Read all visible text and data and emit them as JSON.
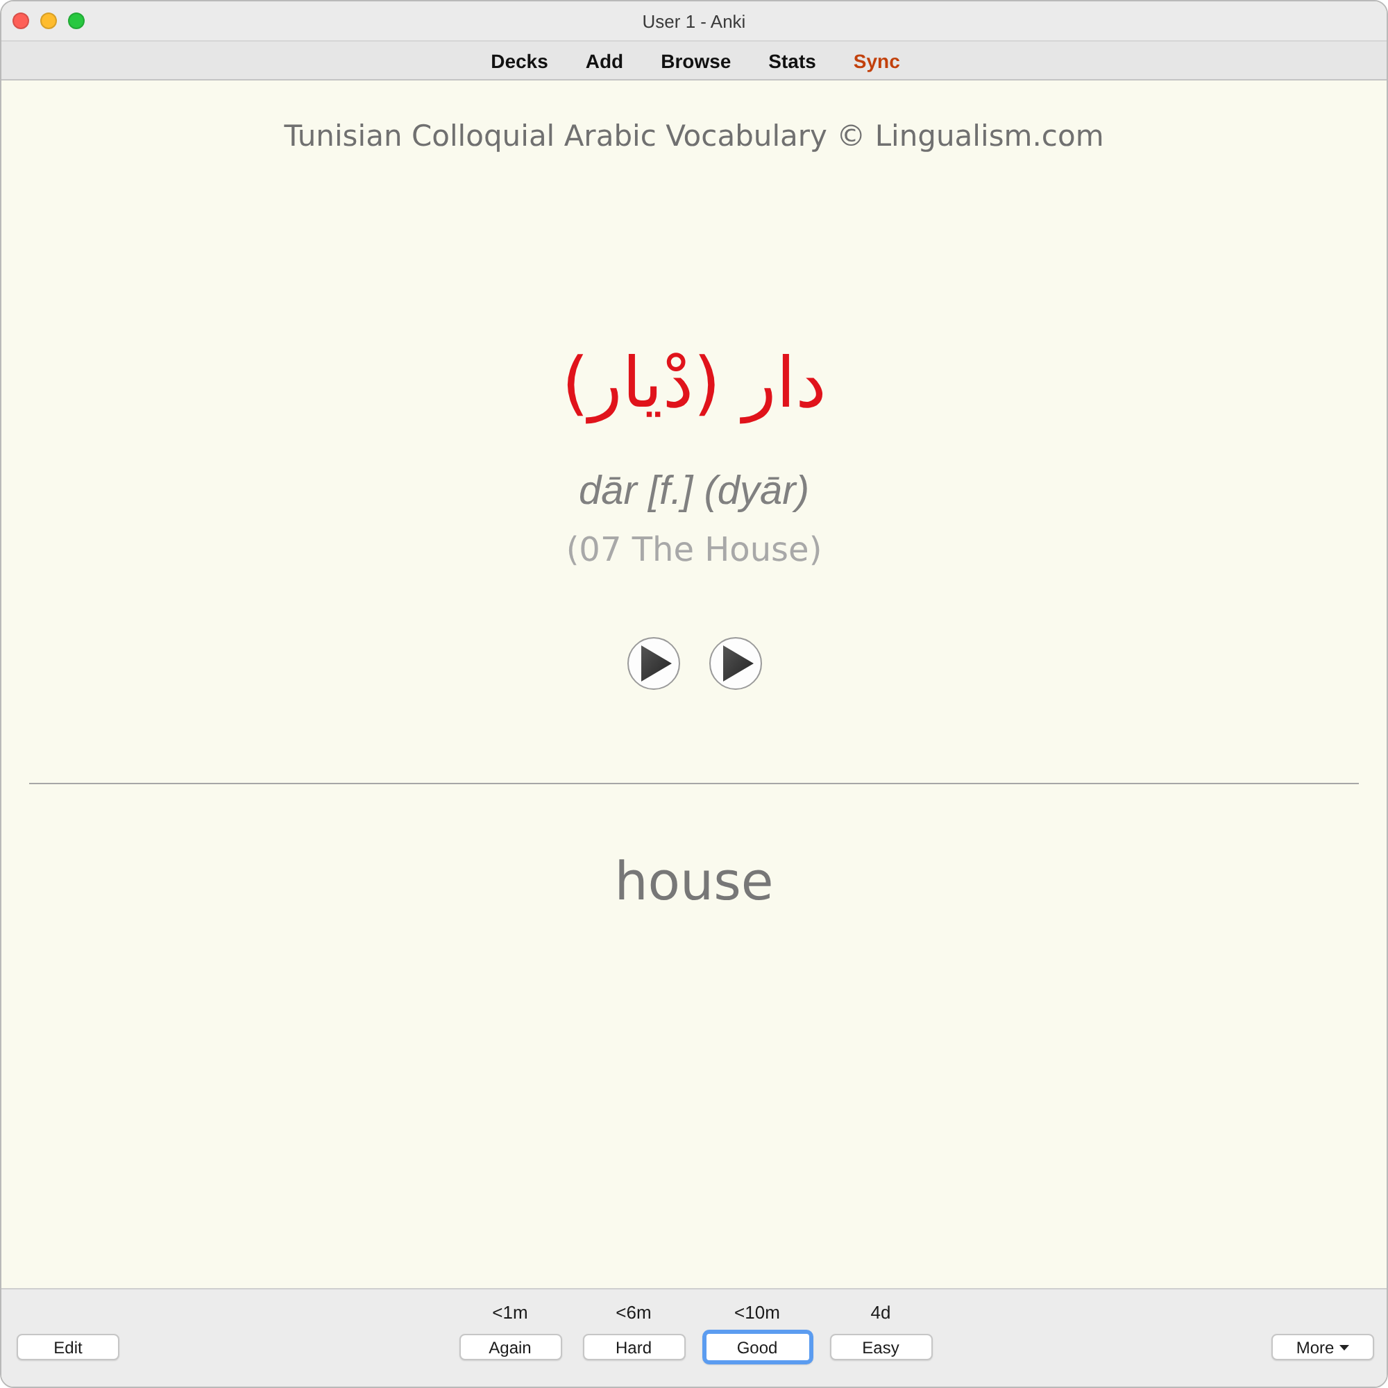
{
  "window": {
    "title": "User 1 - Anki"
  },
  "toolbar": {
    "items": [
      {
        "label": "Decks",
        "highlighted": false
      },
      {
        "label": "Add",
        "highlighted": false
      },
      {
        "label": "Browse",
        "highlighted": false
      },
      {
        "label": "Stats",
        "highlighted": false
      },
      {
        "label": "Sync",
        "highlighted": true
      }
    ]
  },
  "card": {
    "header": "Tunisian Colloquial Arabic Vocabulary © Lingualism.com",
    "arabic": "دار (دْيار)",
    "transliteration": "dār [f.] (dyār)",
    "category": "(07 The House)",
    "audio_buttons": [
      {
        "kind": "play"
      },
      {
        "kind": "play"
      }
    ],
    "answer": "house"
  },
  "bottom_bar": {
    "edit_button": "Edit",
    "answers": [
      {
        "interval": "<1m",
        "label": "Again",
        "selected": false
      },
      {
        "interval": "<6m",
        "label": "Hard",
        "selected": false
      },
      {
        "interval": "<10m",
        "label": "Good",
        "selected": true
      },
      {
        "interval": "4d",
        "label": "Easy",
        "selected": false
      }
    ],
    "more_button": "More"
  }
}
